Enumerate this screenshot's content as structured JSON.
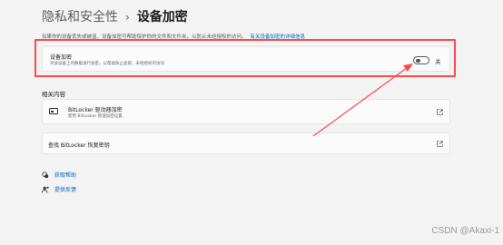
{
  "breadcrumb": {
    "parent": "隐私和安全性",
    "separator": "›",
    "current": "设备加密"
  },
  "intro": {
    "text": "如果你的设备丢失或被盗，设备加密可帮助保护你的文件和文件夹，以防止未经授权的访问。",
    "link": "有关设备加密的详细信息"
  },
  "device_encryption": {
    "title": "设备加密",
    "subtitle": "对该设备上的数据进行加密，以帮助防止盗取，未经授权的访问",
    "toggle_state": "关",
    "toggle_on": false
  },
  "related": {
    "section_title": "相关内容",
    "bitlocker": {
      "title": "BitLocker 驱动器加密",
      "subtitle": "使用 BitLocker 管理加密设置"
    },
    "recovery": {
      "title": "查找 BitLocker 恢复密钥"
    }
  },
  "help": {
    "get_help": "获取帮助",
    "feedback": "提供反馈"
  },
  "watermark": "CSDN @Akaxi-1",
  "colors": {
    "accent": "#0067c0",
    "highlight": "#ff4a4a",
    "background": "#f3f3f3",
    "card": "#fbfbfb"
  }
}
